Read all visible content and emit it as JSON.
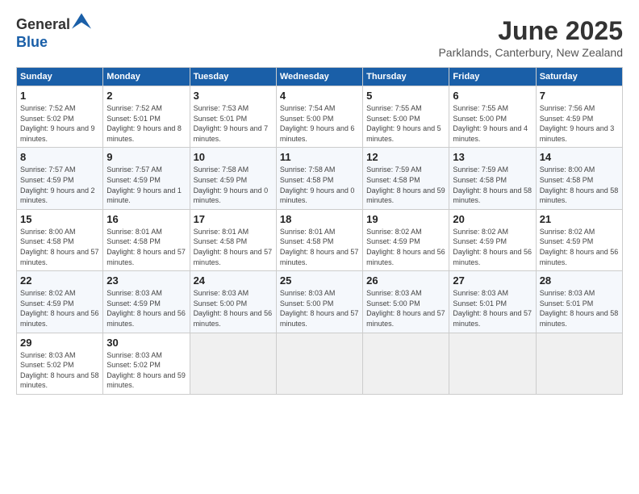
{
  "header": {
    "logo_line1": "General",
    "logo_line2": "Blue",
    "month": "June 2025",
    "location": "Parklands, Canterbury, New Zealand"
  },
  "weekdays": [
    "Sunday",
    "Monday",
    "Tuesday",
    "Wednesday",
    "Thursday",
    "Friday",
    "Saturday"
  ],
  "weeks": [
    [
      {
        "day": "1",
        "sunrise": "7:52 AM",
        "sunset": "5:02 PM",
        "daylight": "9 hours and 9 minutes."
      },
      {
        "day": "2",
        "sunrise": "7:52 AM",
        "sunset": "5:01 PM",
        "daylight": "9 hours and 8 minutes."
      },
      {
        "day": "3",
        "sunrise": "7:53 AM",
        "sunset": "5:01 PM",
        "daylight": "9 hours and 7 minutes."
      },
      {
        "day": "4",
        "sunrise": "7:54 AM",
        "sunset": "5:00 PM",
        "daylight": "9 hours and 6 minutes."
      },
      {
        "day": "5",
        "sunrise": "7:55 AM",
        "sunset": "5:00 PM",
        "daylight": "9 hours and 5 minutes."
      },
      {
        "day": "6",
        "sunrise": "7:55 AM",
        "sunset": "5:00 PM",
        "daylight": "9 hours and 4 minutes."
      },
      {
        "day": "7",
        "sunrise": "7:56 AM",
        "sunset": "4:59 PM",
        "daylight": "9 hours and 3 minutes."
      }
    ],
    [
      {
        "day": "8",
        "sunrise": "7:57 AM",
        "sunset": "4:59 PM",
        "daylight": "9 hours and 2 minutes."
      },
      {
        "day": "9",
        "sunrise": "7:57 AM",
        "sunset": "4:59 PM",
        "daylight": "9 hours and 1 minute."
      },
      {
        "day": "10",
        "sunrise": "7:58 AM",
        "sunset": "4:59 PM",
        "daylight": "9 hours and 0 minutes."
      },
      {
        "day": "11",
        "sunrise": "7:58 AM",
        "sunset": "4:58 PM",
        "daylight": "9 hours and 0 minutes."
      },
      {
        "day": "12",
        "sunrise": "7:59 AM",
        "sunset": "4:58 PM",
        "daylight": "8 hours and 59 minutes."
      },
      {
        "day": "13",
        "sunrise": "7:59 AM",
        "sunset": "4:58 PM",
        "daylight": "8 hours and 58 minutes."
      },
      {
        "day": "14",
        "sunrise": "8:00 AM",
        "sunset": "4:58 PM",
        "daylight": "8 hours and 58 minutes."
      }
    ],
    [
      {
        "day": "15",
        "sunrise": "8:00 AM",
        "sunset": "4:58 PM",
        "daylight": "8 hours and 57 minutes."
      },
      {
        "day": "16",
        "sunrise": "8:01 AM",
        "sunset": "4:58 PM",
        "daylight": "8 hours and 57 minutes."
      },
      {
        "day": "17",
        "sunrise": "8:01 AM",
        "sunset": "4:58 PM",
        "daylight": "8 hours and 57 minutes."
      },
      {
        "day": "18",
        "sunrise": "8:01 AM",
        "sunset": "4:58 PM",
        "daylight": "8 hours and 57 minutes."
      },
      {
        "day": "19",
        "sunrise": "8:02 AM",
        "sunset": "4:59 PM",
        "daylight": "8 hours and 56 minutes."
      },
      {
        "day": "20",
        "sunrise": "8:02 AM",
        "sunset": "4:59 PM",
        "daylight": "8 hours and 56 minutes."
      },
      {
        "day": "21",
        "sunrise": "8:02 AM",
        "sunset": "4:59 PM",
        "daylight": "8 hours and 56 minutes."
      }
    ],
    [
      {
        "day": "22",
        "sunrise": "8:02 AM",
        "sunset": "4:59 PM",
        "daylight": "8 hours and 56 minutes."
      },
      {
        "day": "23",
        "sunrise": "8:03 AM",
        "sunset": "4:59 PM",
        "daylight": "8 hours and 56 minutes."
      },
      {
        "day": "24",
        "sunrise": "8:03 AM",
        "sunset": "5:00 PM",
        "daylight": "8 hours and 56 minutes."
      },
      {
        "day": "25",
        "sunrise": "8:03 AM",
        "sunset": "5:00 PM",
        "daylight": "8 hours and 57 minutes."
      },
      {
        "day": "26",
        "sunrise": "8:03 AM",
        "sunset": "5:00 PM",
        "daylight": "8 hours and 57 minutes."
      },
      {
        "day": "27",
        "sunrise": "8:03 AM",
        "sunset": "5:01 PM",
        "daylight": "8 hours and 57 minutes."
      },
      {
        "day": "28",
        "sunrise": "8:03 AM",
        "sunset": "5:01 PM",
        "daylight": "8 hours and 58 minutes."
      }
    ],
    [
      {
        "day": "29",
        "sunrise": "8:03 AM",
        "sunset": "5:02 PM",
        "daylight": "8 hours and 58 minutes."
      },
      {
        "day": "30",
        "sunrise": "8:03 AM",
        "sunset": "5:02 PM",
        "daylight": "8 hours and 59 minutes."
      },
      null,
      null,
      null,
      null,
      null
    ]
  ]
}
